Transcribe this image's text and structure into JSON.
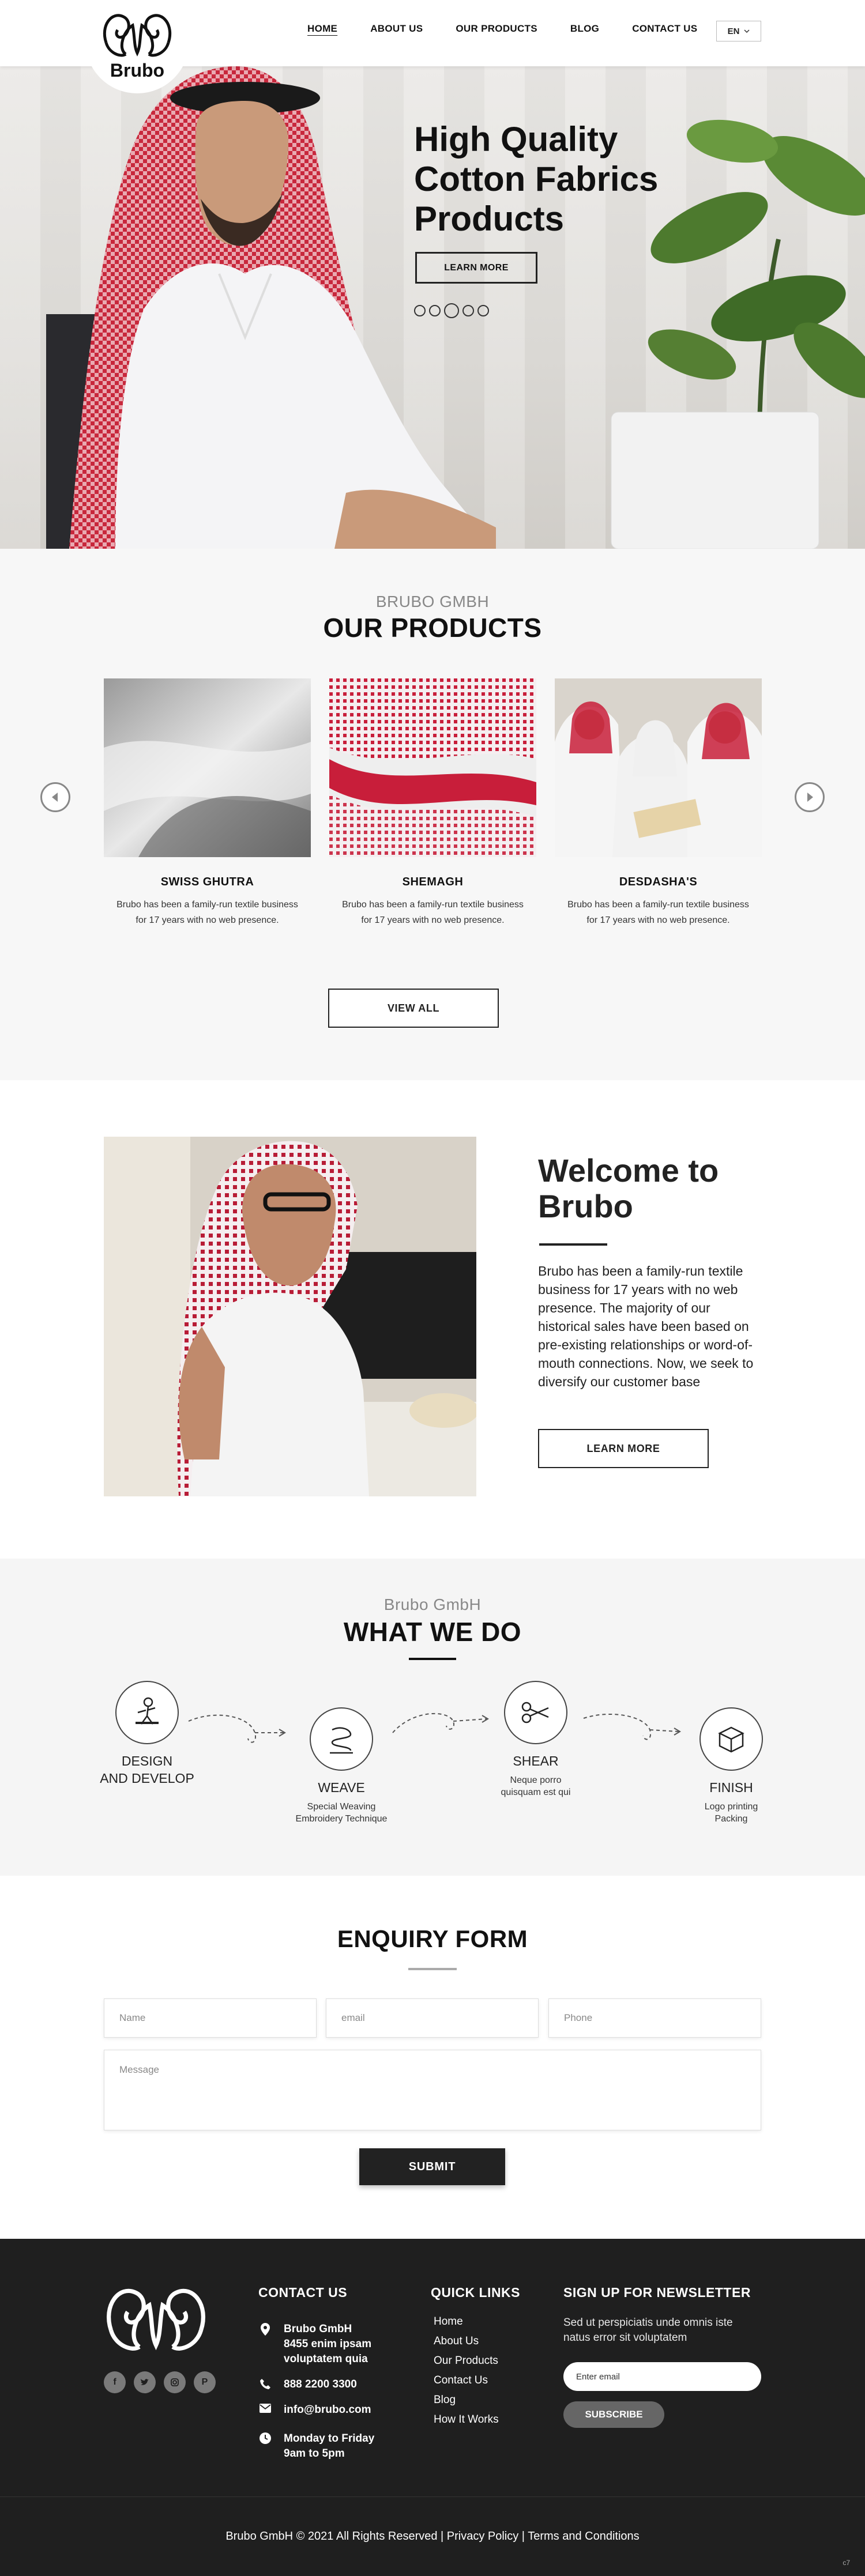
{
  "header": {
    "logo_text": "Brubo",
    "nav": [
      {
        "label": "HOME",
        "active": true
      },
      {
        "label": "ABOUT US",
        "active": false
      },
      {
        "label": "OUR PRODUCTS",
        "active": false
      },
      {
        "label": "BLOG",
        "active": false
      },
      {
        "label": "CONTACT US",
        "active": false
      }
    ],
    "lang": "EN"
  },
  "hero": {
    "title": "High Quality Cotton Fabrics Products",
    "button": "LEARN MORE",
    "slides": 5,
    "active_slide": 3
  },
  "products": {
    "subtitle": "BRUBO GMBH",
    "title": "OUR PRODUCTS",
    "items": [
      {
        "name": "SWISS GHUTRA",
        "desc": "Brubo has been a family-run textile business for 17 years with no web presence."
      },
      {
        "name": "SHEMAGH",
        "desc": "Brubo has been a family-run textile business for 17 years with no web presence."
      },
      {
        "name": "DESDASHA'S",
        "desc": "Brubo has been a family-run textile business for 17 years with no web presence."
      }
    ],
    "view_all": "VIEW ALL"
  },
  "welcome": {
    "title": "Welcome to Brubo",
    "text": "Brubo has been a family-run textile business for 17 years with no web presence. The majority of our historical sales have been based on pre-existing relationships or word-of-mouth connections. Now, we seek to diversify our customer base",
    "button": "LEARN MORE"
  },
  "what_we_do": {
    "subtitle": "Brubo GmbH",
    "title": "WHAT WE DO",
    "steps": [
      {
        "title": "DESIGN\nAND DEVELOP",
        "desc": "",
        "icon": "designer-icon"
      },
      {
        "title": "WEAVE",
        "desc": "Special Weaving\nEmbroidery Technique",
        "icon": "weave-icon"
      },
      {
        "title": "SHEAR",
        "desc": "Neque porro\nquisquam est qui",
        "icon": "scissors-icon"
      },
      {
        "title": "FINISH",
        "desc": "Logo printing\nPacking",
        "icon": "box-icon"
      }
    ]
  },
  "enquiry": {
    "title": "ENQUIRY FORM",
    "name_placeholder": "Name",
    "email_placeholder": "email",
    "phone_placeholder": "Phone",
    "message_placeholder": "Message",
    "submit": "SUBMIT"
  },
  "footer": {
    "contact_head": "CONTACT US",
    "address": "Brubo GmbH\n8455 enim ipsam\nvoluptatem quia",
    "phone": "888 2200 3300",
    "email": "info@brubo.com",
    "hours": "Monday to Friday\n9am to 5pm",
    "links_head": "QUICK LINKS",
    "links": [
      "Home",
      "About Us",
      "Our Products",
      "Contact Us",
      "Blog",
      "How It Works"
    ],
    "newsletter_head": "SIGN UP FOR NEWSLETTER",
    "newsletter_text": "Sed ut perspiciatis unde omnis iste natus error sit voluptatem",
    "newsletter_placeholder": "Enter email",
    "subscribe": "SUBSCRIBE",
    "copyright": "Brubo GmbH © 2021 All Rights Reserved | Privacy Policy | Terms and Conditions",
    "corner": "c7"
  }
}
